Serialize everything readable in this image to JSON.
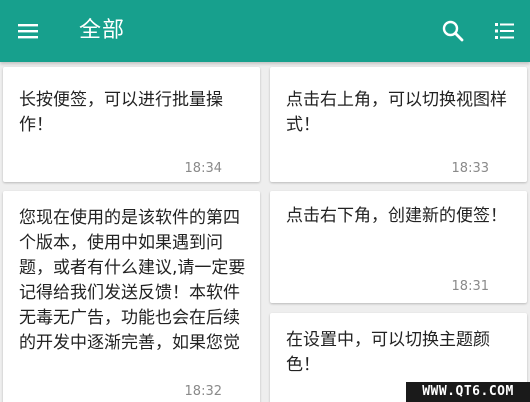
{
  "appbar": {
    "title": "全部",
    "color": "#17a08d",
    "menu_icon": "hamburger-menu-icon",
    "search_icon": "search-icon",
    "view_icon": "list-view-icon"
  },
  "notes": [
    {
      "text": "长按便签，可以进行批量操作！",
      "time": "18:34"
    },
    {
      "text": "点击右上角，可以切换视图样式！",
      "time": "18:33"
    },
    {
      "text": "您现在使用的是该软件的第四个版本，使用中如果遇到问题，或者有什么建议,请一定要记得给我们发送反馈！本软件无毒无广告，功能也会在后续的开发中逐渐完善，如果您觉得好用，可以...",
      "time": "18:32"
    },
    {
      "text": "点击右下角，创建新的便签！",
      "time": "18:31"
    },
    {
      "text": "在设置中，可以切换主题颜色！",
      "time": ""
    }
  ],
  "watermark": "WWW.QT6.COM"
}
